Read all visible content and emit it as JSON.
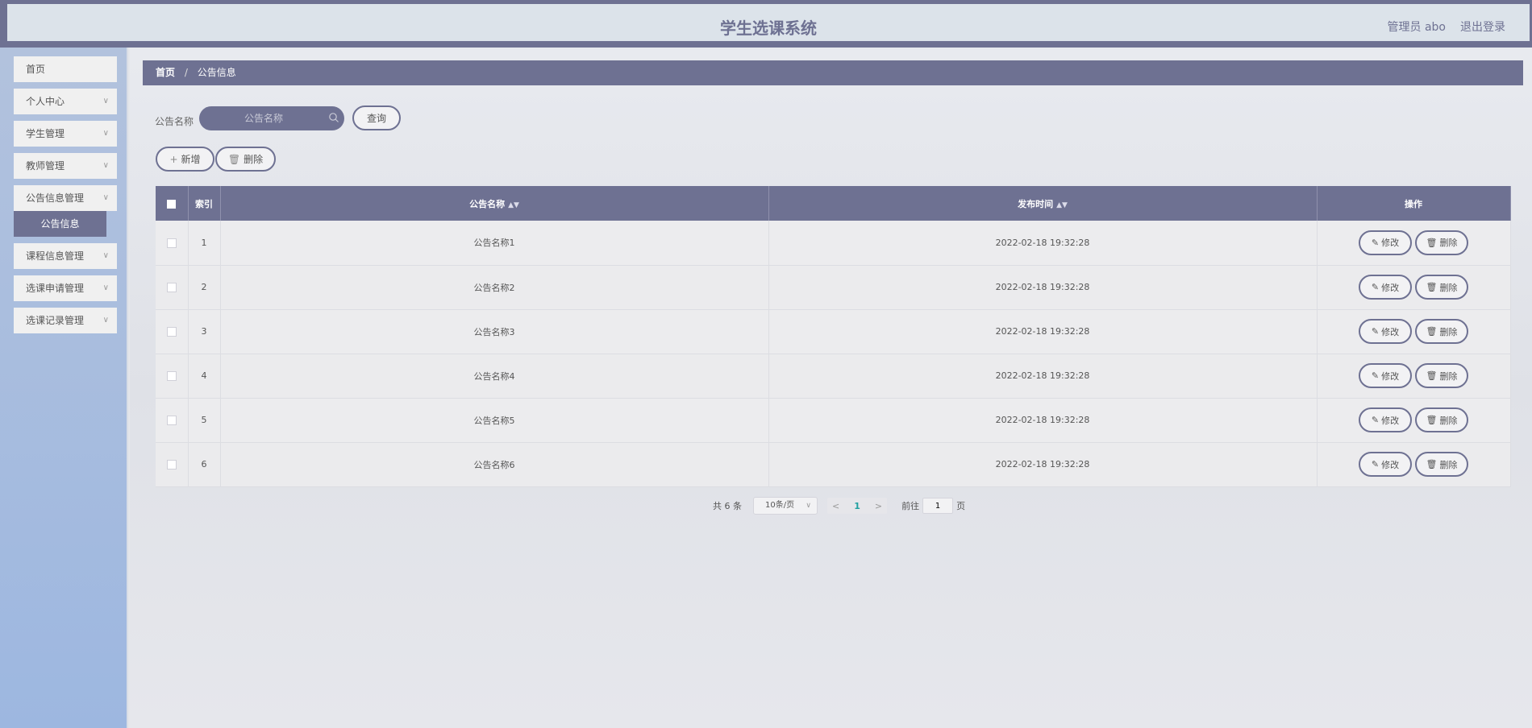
{
  "header": {
    "title": "学生选课系统",
    "role_user": "管理员 abo",
    "logout": "退出登录"
  },
  "sidebar": {
    "items": [
      {
        "label": "首页",
        "has_chevron": false
      },
      {
        "label": "个人中心",
        "has_chevron": true
      },
      {
        "label": "学生管理",
        "has_chevron": true
      },
      {
        "label": "教师管理",
        "has_chevron": true
      },
      {
        "label": "公告信息管理",
        "has_chevron": true
      },
      {
        "label": "课程信息管理",
        "has_chevron": true
      },
      {
        "label": "选课申请管理",
        "has_chevron": true
      },
      {
        "label": "选课记录管理",
        "has_chevron": true
      }
    ],
    "active_submenu": "公告信息"
  },
  "breadcrumb": {
    "home": "首页",
    "separator": "/",
    "current": "公告信息"
  },
  "search": {
    "label": "公告名称",
    "placeholder": "公告名称",
    "query_button": "查询"
  },
  "actions": {
    "add": "新增",
    "delete": "删除"
  },
  "table": {
    "columns": [
      "索引",
      "公告名称",
      "发布时间",
      "操作"
    ],
    "rows": [
      {
        "index": "1",
        "name": "公告名称1",
        "time": "2022-02-18 19:32:28"
      },
      {
        "index": "2",
        "name": "公告名称2",
        "time": "2022-02-18 19:32:28"
      },
      {
        "index": "3",
        "name": "公告名称3",
        "time": "2022-02-18 19:32:28"
      },
      {
        "index": "4",
        "name": "公告名称4",
        "time": "2022-02-18 19:32:28"
      },
      {
        "index": "5",
        "name": "公告名称5",
        "time": "2022-02-18 19:32:28"
      },
      {
        "index": "6",
        "name": "公告名称6",
        "time": "2022-02-18 19:32:28"
      }
    ],
    "edit_label": "修改",
    "delete_label": "删除"
  },
  "pagination": {
    "total": "共 6 条",
    "page_size": "10条/页",
    "current_page": "1",
    "goto_prefix": "前往",
    "goto_value": "1",
    "goto_suffix": "页"
  },
  "colors": {
    "primary": "#6e7192",
    "header_bg": "#dce3ea",
    "sidebar_bg": "#a9bfe0"
  }
}
